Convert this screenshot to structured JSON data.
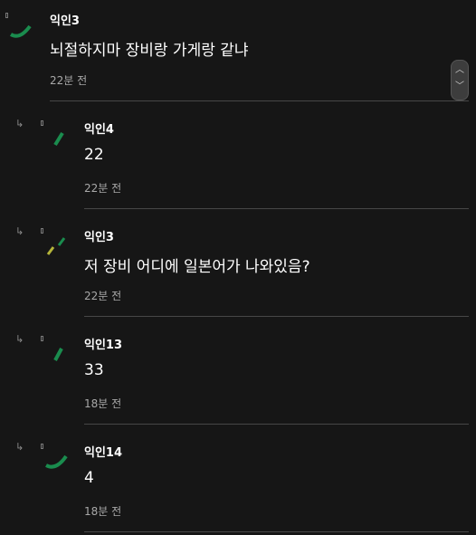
{
  "comments": [
    {
      "nickname": "익인3",
      "body": "뇌절하지마 장비랑 가게랑 같냐",
      "time": "22분 전",
      "is_reply": false,
      "avatar_icon": "arc-icon",
      "avatar_color": "#1a8c4e"
    },
    {
      "nickname": "익인4",
      "body": "22",
      "time": "22분 전",
      "is_reply": true,
      "avatar_icon": "stroke-icon",
      "avatar_color": "#1a8c4e"
    },
    {
      "nickname": "익인3",
      "body": "저 장비 어디에 일본어가 나와있음?",
      "time": "22분 전",
      "is_reply": true,
      "avatar_icon": "double-stroke-icon",
      "avatar_color": "#b5b53a"
    },
    {
      "nickname": "익인13",
      "body": "33",
      "time": "18분 전",
      "is_reply": true,
      "avatar_icon": "stroke-icon",
      "avatar_color": "#1a8c4e"
    },
    {
      "nickname": "익인14",
      "body": "4",
      "time": "18분 전",
      "is_reply": true,
      "avatar_icon": "arc-icon",
      "avatar_color": "#1a8c4e"
    }
  ],
  "icons": {
    "reply": "reply-arrow-icon",
    "anchor": "bookmark-icon",
    "scroll_up": "chevron-up-icon",
    "scroll_down": "chevron-down-icon"
  }
}
